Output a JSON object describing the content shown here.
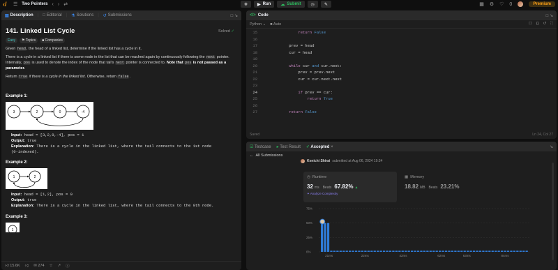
{
  "topbar": {
    "problem_list": "Two Pointers",
    "run": "Run",
    "submit": "Submit",
    "notifications": "0",
    "premium": "Premium"
  },
  "left": {
    "tabs": [
      {
        "label": "Description"
      },
      {
        "label": "Editorial"
      },
      {
        "label": "Solutions"
      },
      {
        "label": "Submissions"
      }
    ],
    "title": "141. Linked List Cycle",
    "solved": "Solved",
    "tags": [
      "Easy",
      "Topics",
      "Companies"
    ],
    "desc1_a": "Given ",
    "desc1_code": "head",
    "desc1_b": ", the head of a linked list, determine if the linked list has a cycle in it.",
    "desc2_a": "There is a cycle in a linked list if there is some node in the list that can be reached again by continuously following the ",
    "desc2_code1": "next",
    "desc2_b": " pointer. Internally, ",
    "desc2_code2": "pos",
    "desc2_c": " is used to denote the index of the node that tail's ",
    "desc2_code3": "next",
    "desc2_d": " pointer is connected to. ",
    "desc2_bold1": "Note that ",
    "desc2_code4": "pos",
    "desc2_bold2": " is not passed as a parameter.",
    "desc3_a": "Return ",
    "desc3_code1": "true",
    "desc3_b": " if there is a cycle in the linked list",
    "desc3_c": ". Otherwise, return ",
    "desc3_code2": "false",
    "desc3_d": ".",
    "examples": [
      {
        "title": "Example 1:",
        "nodes": [
          "3",
          "2",
          "0",
          "-4"
        ],
        "input_label": "Input:",
        "input": " head = [3,2,0,-4], pos = 1",
        "output_label": "Output:",
        "output": " true",
        "expl_label": "Explanation:",
        "expl": " There is a cycle in the linked list, where the tail connects to the 1st node",
        "expl2": "(0-indexed)."
      },
      {
        "title": "Example 2:",
        "nodes": [
          "1",
          "2"
        ],
        "input_label": "Input:",
        "input": " head = [1,2], pos = 0",
        "output_label": "Output:",
        "output": " true",
        "expl_label": "Explanation:",
        "expl": " There is a cycle in the linked list, where the tail connects to the 0th node."
      },
      {
        "title": "Example 3:",
        "nodes": [
          "1"
        ]
      }
    ],
    "likes": "15.6K",
    "comments": "274"
  },
  "code": {
    "header": "Code",
    "language": "Python",
    "auto": "Auto",
    "saved": "Saved",
    "cursor": "Ln 24, Col 27",
    "lines": [
      {
        "n": "15",
        "code": "        return False"
      },
      {
        "n": "16",
        "code": ""
      },
      {
        "n": "17",
        "code": "    prev = head"
      },
      {
        "n": "18",
        "code": "    cur = head"
      },
      {
        "n": "19",
        "code": ""
      },
      {
        "n": "20",
        "code": "    while cur and cur.next:"
      },
      {
        "n": "21",
        "code": "        prev = prev.next"
      },
      {
        "n": "22",
        "code": "        cur = cur.next.next"
      },
      {
        "n": "23",
        "code": ""
      },
      {
        "n": "24",
        "code": "        if prev == cur:"
      },
      {
        "n": "25",
        "code": "            return True"
      },
      {
        "n": "26",
        "code": ""
      },
      {
        "n": "27",
        "code": "    return False"
      }
    ]
  },
  "result": {
    "tabs": [
      "Testcase",
      "Test Result",
      "Accepted"
    ],
    "back": "All Submissions",
    "username": "Kenichi Shirai",
    "submitted": "submitted at Aug 06, 2024 19:34",
    "runtime": {
      "label": "Runtime",
      "value": "32",
      "unit": "ms",
      "beats_label": "Beats",
      "beats": "67.82%",
      "analyze": "Analyze Complexity"
    },
    "memory": {
      "label": "Memory",
      "value": "18.82",
      "unit": "MB",
      "beats_label": "Beats",
      "beats": "23.21%"
    }
  },
  "chart_data": {
    "type": "bar",
    "y_ticks": [
      "75%",
      "50%",
      "25%",
      "0%"
    ],
    "x_ticks": [
      "21ms",
      "22ms",
      "42ms",
      "62ms",
      "63ms",
      "84ms"
    ],
    "ylim": [
      0,
      75
    ],
    "highlight_value": 50,
    "bars": [
      50,
      50,
      50,
      2,
      2,
      2,
      2,
      2,
      2,
      2,
      2,
      2,
      2,
      2,
      2,
      2,
      2,
      2,
      2,
      2,
      2,
      2,
      2,
      2,
      2,
      2,
      2,
      2,
      2,
      2,
      2,
      2,
      2,
      2,
      2,
      2,
      2,
      2,
      2,
      2,
      2,
      2,
      2,
      2,
      2,
      2,
      2,
      2,
      2,
      2,
      2,
      2,
      2,
      2,
      2,
      2,
      2,
      2,
      2,
      2,
      2,
      2,
      2,
      2,
      2,
      2,
      2
    ]
  }
}
